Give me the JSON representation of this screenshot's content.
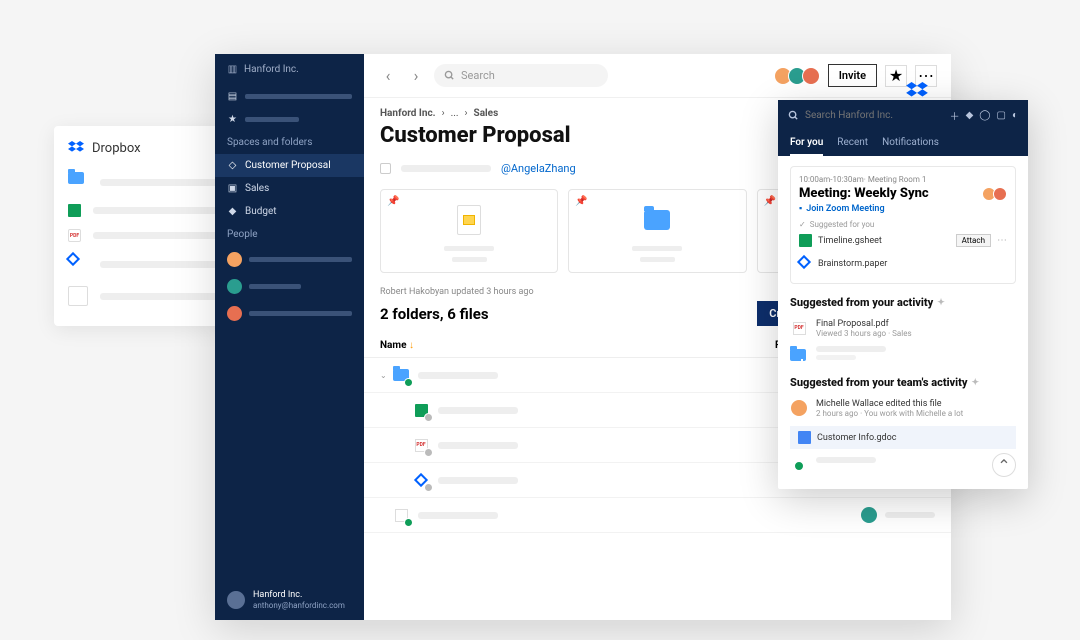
{
  "bg_card": {
    "title": "Dropbox"
  },
  "sidebar": {
    "org": "Hanford Inc.",
    "sections_label": "Spaces and folders",
    "items": [
      "Customer Proposal",
      "Sales",
      "Budget"
    ],
    "people_label": "People",
    "footer_name": "Hanford Inc.",
    "footer_email": "anthony@hanfordinc.com"
  },
  "topbar": {
    "search_placeholder": "Search",
    "invite": "Invite"
  },
  "breadcrumb": [
    "Hanford Inc.",
    "...",
    "Sales"
  ],
  "page_title": "Customer Proposal",
  "mention": "@AngelaZhang",
  "update_meta": "Robert Hakobyan updated 3 hours ago",
  "count_text": "2 folders, 6 files",
  "create_label": "Create",
  "table": {
    "col1": "Name",
    "col2": "Recent activity"
  },
  "panel": {
    "search_placeholder": "Search Hanford Inc.",
    "tabs": [
      "For you",
      "Recent",
      "Notifications"
    ],
    "meeting": {
      "meta": "10:00am-10:30am· Meeting Room 1",
      "title": "Meeting: Weekly Sync",
      "join": "Join Zoom Meeting",
      "suggested_label": "Suggested for you",
      "items": [
        "Timeline.gsheet",
        "Brainstorm.paper"
      ],
      "attach": "Attach"
    },
    "sec1": {
      "title": "Suggested from your activity",
      "file": "Final Proposal.pdf",
      "file_meta": "Viewed 3 hours ago · Sales"
    },
    "sec2": {
      "title": "Suggested from your team's activity",
      "line1": "Michelle Wallace edited this file",
      "line2": "2 hours ago · You work with Michelle a lot",
      "chip": "Customer Info.gdoc"
    }
  }
}
